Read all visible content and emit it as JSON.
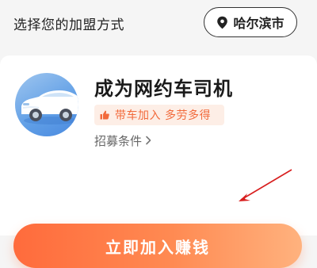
{
  "header": {
    "title": "选择您的加盟方式",
    "city": "哈尔滨市",
    "city_icon": "location-pin-icon"
  },
  "card": {
    "avatar_icon": "car-icon",
    "title": "成为网约车司机",
    "tag": {
      "icon": "thumbs-up-icon",
      "text": "带车加入 多劳多得"
    },
    "requirements_link": "招募条件",
    "join_button": "立即加入赚钱"
  },
  "colors": {
    "accent": "#ff6b3c",
    "tag_bg": "#fdeee6",
    "tag_text": "#f26a3b",
    "annotation_arrow": "#d81e1e"
  }
}
